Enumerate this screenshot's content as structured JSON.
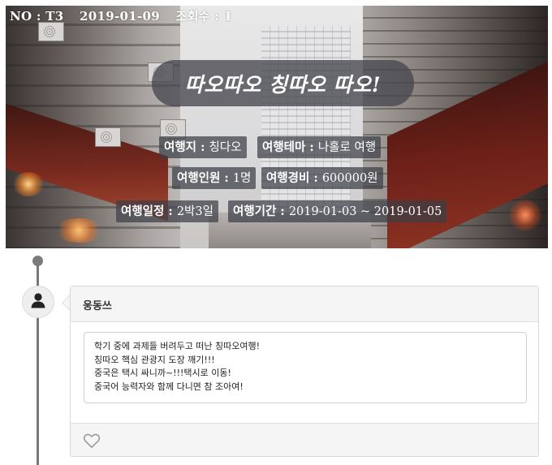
{
  "post": {
    "no_label": "NO : T3",
    "date": "2019-01-09",
    "views_label": "조회수 : 1",
    "title": "따오따오 칭따오 따오!"
  },
  "tags": [
    {
      "key": "여행지 : ",
      "value": "칭다오"
    },
    {
      "key": "여행테마 : ",
      "value": "나홀로 여행"
    },
    {
      "key": "여행인원 : ",
      "value": "1명"
    },
    {
      "key": "여행경비 : ",
      "value": "600000원"
    },
    {
      "key": "여행일정 : ",
      "value": "2박3일"
    },
    {
      "key": "여행기간 : ",
      "value": "2019-01-03 ~ 2019-01-05"
    }
  ],
  "comment": {
    "author": "웅동쓰",
    "lines": [
      "학기 중에 과제들 버려두고 떠난 칭따오여행!",
      "칭따오 핵심 관광지 도장 깨기!!!",
      "중국은 택시 싸니까~!!!택시로 이동!",
      "중국어 능력자와 함께 다니면 참 조아여!"
    ]
  },
  "icons": {
    "avatar": "user-silhouette-icon",
    "like": "heart-outline-icon"
  },
  "colors": {
    "title_bg": "#46464e",
    "timeline": "#777777",
    "card_border": "#d7d7d7",
    "card_header_bg": "#f5f5f5"
  }
}
